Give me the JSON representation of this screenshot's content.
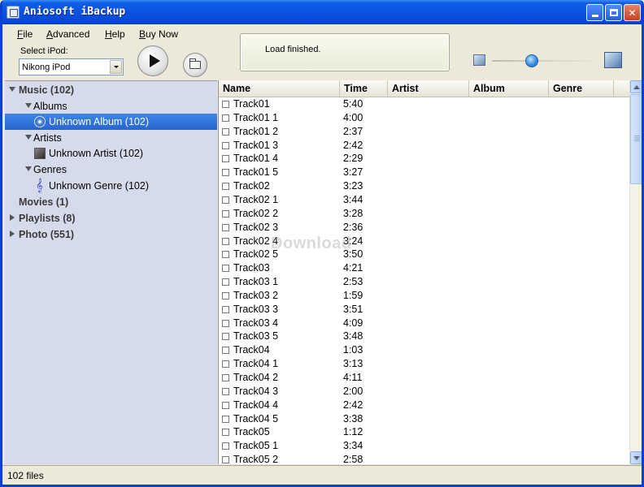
{
  "window": {
    "title": "Aniosoft iBackup"
  },
  "menu": [
    {
      "label": "File",
      "underline_index": 0
    },
    {
      "label": "Advanced",
      "underline_index": 0
    },
    {
      "label": "Help",
      "underline_index": 0
    },
    {
      "label": "Buy Now",
      "underline_index": 0
    }
  ],
  "toolbar": {
    "select_ipod_label": "Select iPod:",
    "selected_ipod": "Nikong iPod",
    "status_message": "Load finished."
  },
  "tree": [
    {
      "label": "Music (102)",
      "bold": true,
      "expander": "down",
      "icon": "",
      "selected": false
    },
    {
      "label": "Albums",
      "bold": false,
      "expander": "down",
      "icon": "",
      "selected": false
    },
    {
      "label": "Unknown Album (102)",
      "bold": false,
      "expander": "",
      "icon": "album-icon",
      "selected": true
    },
    {
      "label": "Artists",
      "bold": false,
      "expander": "down",
      "icon": "",
      "selected": false
    },
    {
      "label": "Unknown Artist (102)",
      "bold": false,
      "expander": "",
      "icon": "artist-icon",
      "selected": false
    },
    {
      "label": "Genres",
      "bold": false,
      "expander": "down",
      "icon": "",
      "selected": false
    },
    {
      "label": "Unknown Genre (102)",
      "bold": false,
      "expander": "",
      "icon": "genre-icon",
      "selected": false
    },
    {
      "label": "Movies (1)",
      "bold": true,
      "expander": "",
      "icon": "",
      "selected": false
    },
    {
      "label": "Playlists (8)",
      "bold": true,
      "expander": "right",
      "icon": "",
      "selected": false
    },
    {
      "label": "Photo (551)",
      "bold": true,
      "expander": "right",
      "icon": "",
      "selected": false
    }
  ],
  "columns": [
    "Name",
    "Time",
    "Artist",
    "Album",
    "Genre"
  ],
  "tracks": [
    {
      "name": "Track01",
      "time": "5:40"
    },
    {
      "name": "Track01 1",
      "time": "4:00"
    },
    {
      "name": "Track01 2",
      "time": "2:37"
    },
    {
      "name": "Track01 3",
      "time": "2:42"
    },
    {
      "name": "Track01 4",
      "time": "2:29"
    },
    {
      "name": "Track01 5",
      "time": "3:27"
    },
    {
      "name": "Track02",
      "time": "3:23"
    },
    {
      "name": "Track02 1",
      "time": "3:44"
    },
    {
      "name": "Track02 2",
      "time": "3:28"
    },
    {
      "name": "Track02 3",
      "time": "2:36"
    },
    {
      "name": "Track02 4",
      "time": "3:24"
    },
    {
      "name": "Track02 5",
      "time": "3:50"
    },
    {
      "name": "Track03",
      "time": "4:21"
    },
    {
      "name": "Track03 1",
      "time": "2:53"
    },
    {
      "name": "Track03 2",
      "time": "1:59"
    },
    {
      "name": "Track03 3",
      "time": "3:51"
    },
    {
      "name": "Track03 4",
      "time": "4:09"
    },
    {
      "name": "Track03 5",
      "time": "3:48"
    },
    {
      "name": "Track04",
      "time": "1:03"
    },
    {
      "name": "Track04 1",
      "time": "3:13"
    },
    {
      "name": "Track04 2",
      "time": "4:11"
    },
    {
      "name": "Track04 3",
      "time": "2:00"
    },
    {
      "name": "Track04 4",
      "time": "2:42"
    },
    {
      "name": "Track04 5",
      "time": "3:38"
    },
    {
      "name": "Track05",
      "time": "1:12"
    },
    {
      "name": "Track05 1",
      "time": "3:34"
    },
    {
      "name": "Track05 2",
      "time": "2:58"
    }
  ],
  "status_bar": {
    "text": "102 files"
  },
  "watermark": "Download"
}
